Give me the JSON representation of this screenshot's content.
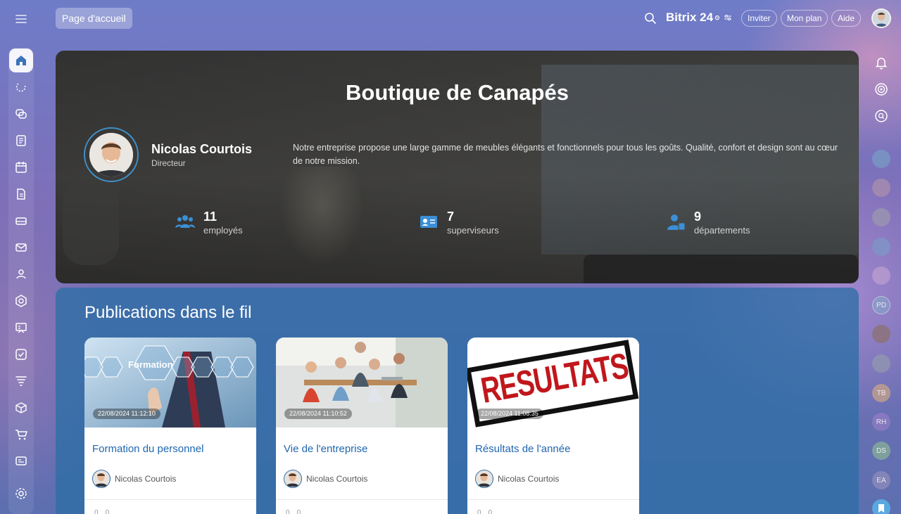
{
  "header": {
    "home_tab": "Page d'accueil",
    "brand_name": "Bitrix 24",
    "brand_clock": "⊙",
    "invite_label": "Inviter",
    "plan_label": "Mon plan",
    "help_label": "Aide"
  },
  "company": {
    "title": "Boutique de Canapés",
    "ceo_name": "Nicolas Courtois",
    "ceo_role": "Directeur",
    "description": "Notre entreprise propose une large gamme de meubles élégants et fonctionnels pour tous les goûts. Qualité, confort et design sont au cœur de notre mission.",
    "stats": [
      {
        "value": "11",
        "label": "employés",
        "icon": "people-icon"
      },
      {
        "value": "7",
        "label": "superviseurs",
        "icon": "id-card-icon"
      },
      {
        "value": "9",
        "label": "départements",
        "icon": "department-icon"
      }
    ]
  },
  "publications": {
    "title": "Publications dans le fil",
    "posts": [
      {
        "date": "22/08/2024 11:12:10",
        "title": "Formation du personnel",
        "author": "Nicolas Courtois",
        "image_text": "Formation",
        "likes": "0",
        "comments": "0"
      },
      {
        "date": "22/08/2024 11:10:52",
        "title": "Vie de l'entreprise",
        "author": "Nicolas Courtois",
        "likes": "0",
        "comments": "0"
      },
      {
        "date": "22/08/2024 11:08:35",
        "title": "Résultats de l'année",
        "author": "Nicolas Courtois",
        "image_text": "RESULTATS",
        "likes": "0",
        "comments": "0"
      }
    ]
  },
  "right_bar": {
    "initials": [
      "PD",
      "TB",
      "RH",
      "DS",
      "EA"
    ]
  },
  "colors": {
    "accent": "#2067b0",
    "stat_icon": "#3b8fd6",
    "pubs_panel": "#2d6ea5"
  }
}
